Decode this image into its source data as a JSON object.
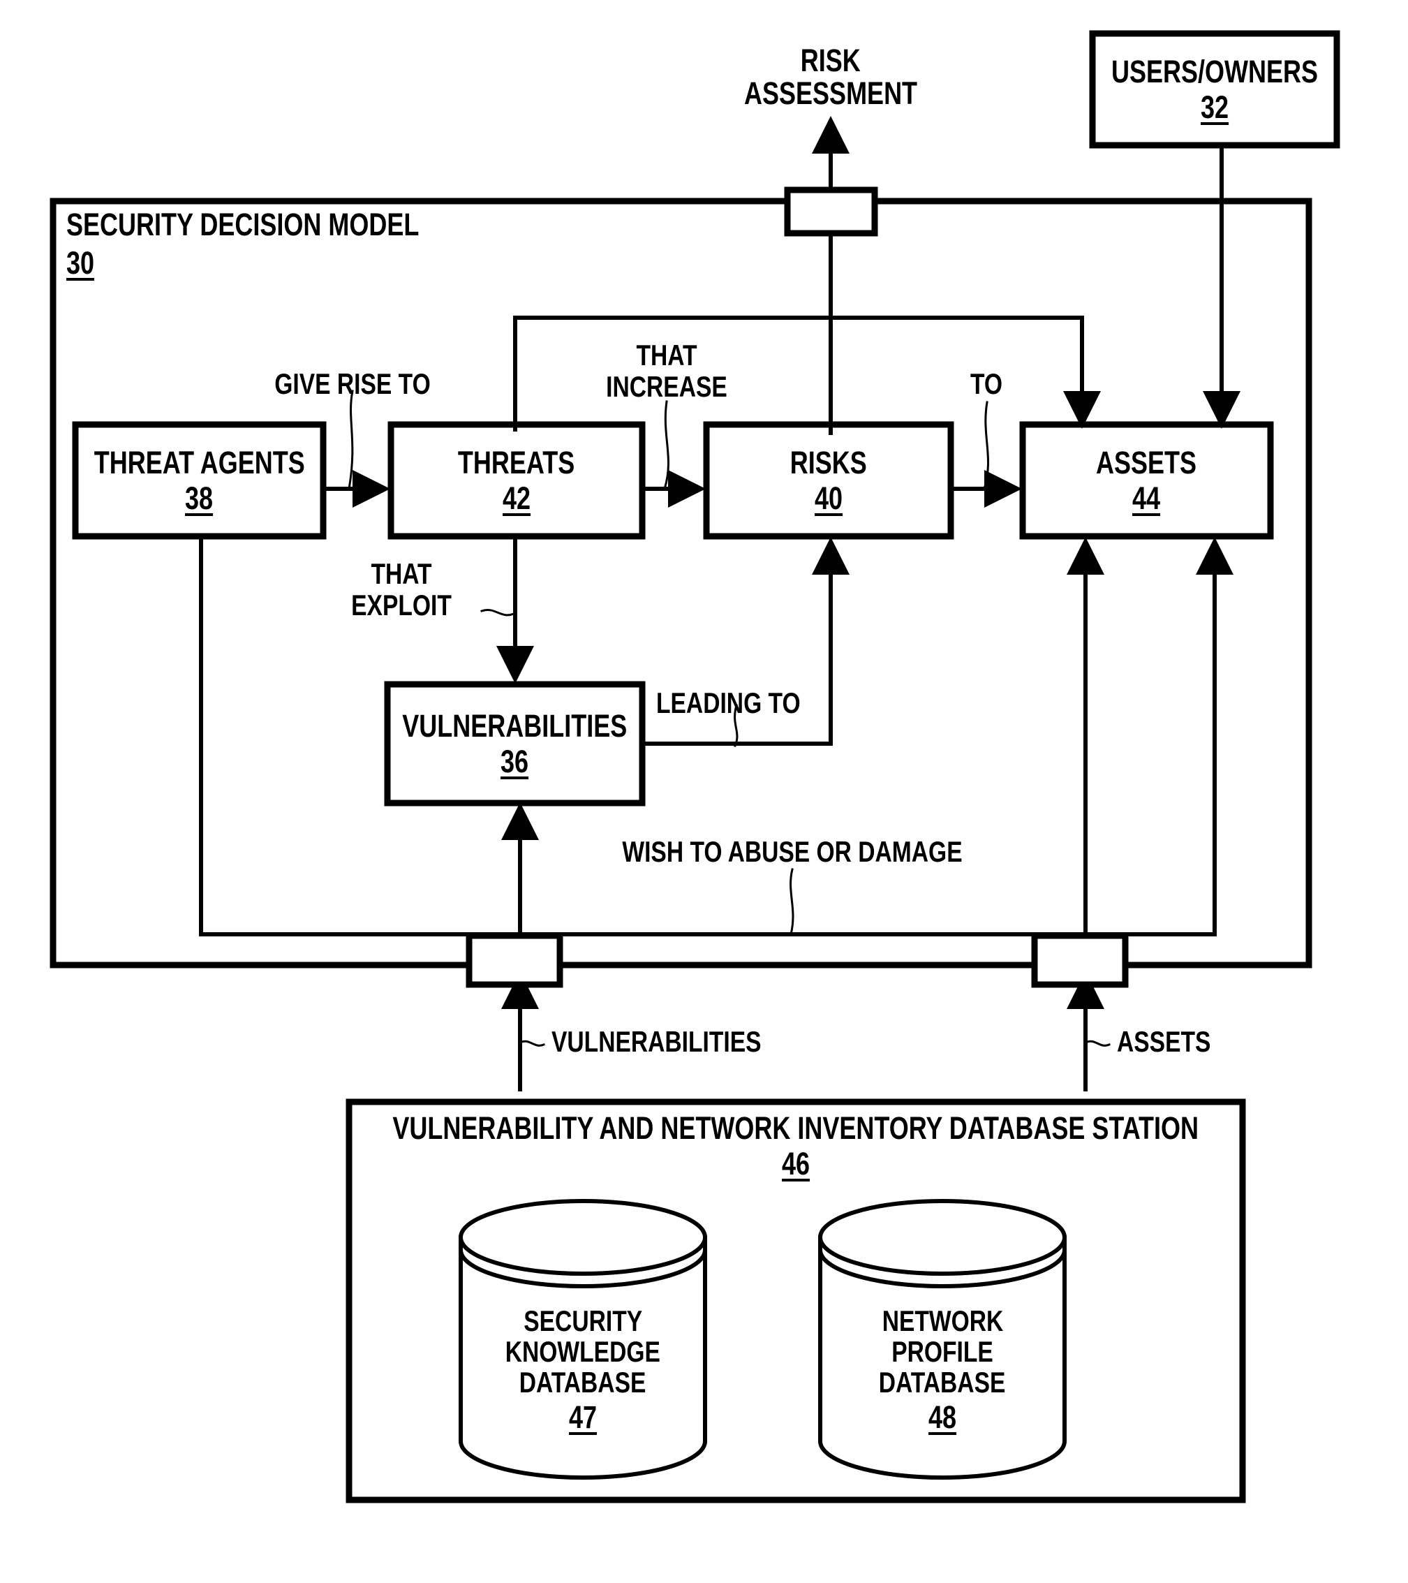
{
  "figure": {
    "title": "Security Decision Model Diagram",
    "ink_color": "#000000",
    "background": "#ffffff"
  },
  "external": {
    "risk_assessment": {
      "line1": "RISK",
      "line2": "ASSESSMENT"
    },
    "users_owners": {
      "label": "USERS/OWNERS",
      "ref": "32"
    }
  },
  "model": {
    "label": "SECURITY DECISION MODEL",
    "ref": "30"
  },
  "boxes": [
    {
      "label": "THREAT AGENTS",
      "ref": "38"
    },
    {
      "label": "THREATS",
      "ref": "42"
    },
    {
      "label": "RISKS",
      "ref": "40"
    },
    {
      "label": "ASSETS",
      "ref": "44"
    },
    {
      "label": "VULNERABILITIES",
      "ref": "36"
    }
  ],
  "edge_labels": {
    "give_rise_to": "GIVE RISE TO",
    "that_increase_l1": "THAT",
    "that_increase_l2": "INCREASE",
    "to": "TO",
    "that_exploit_l1": "THAT",
    "that_exploit_l2": "EXPLOIT",
    "leading_to": "LEADING TO",
    "wish_to_abuse": "WISH TO ABUSE OR DAMAGE",
    "vulnerabilities_feed": "VULNERABILITIES",
    "assets_feed": "ASSETS"
  },
  "station": {
    "title": "VULNERABILITY AND NETWORK INVENTORY DATABASE STATION",
    "ref": "46",
    "databases": [
      {
        "line1": "SECURITY",
        "line2": "KNOWLEDGE",
        "line3": "DATABASE",
        "ref": "47"
      },
      {
        "line1": "NETWORK",
        "line2": "PROFILE",
        "line3": "DATABASE",
        "ref": "48"
      }
    ]
  }
}
